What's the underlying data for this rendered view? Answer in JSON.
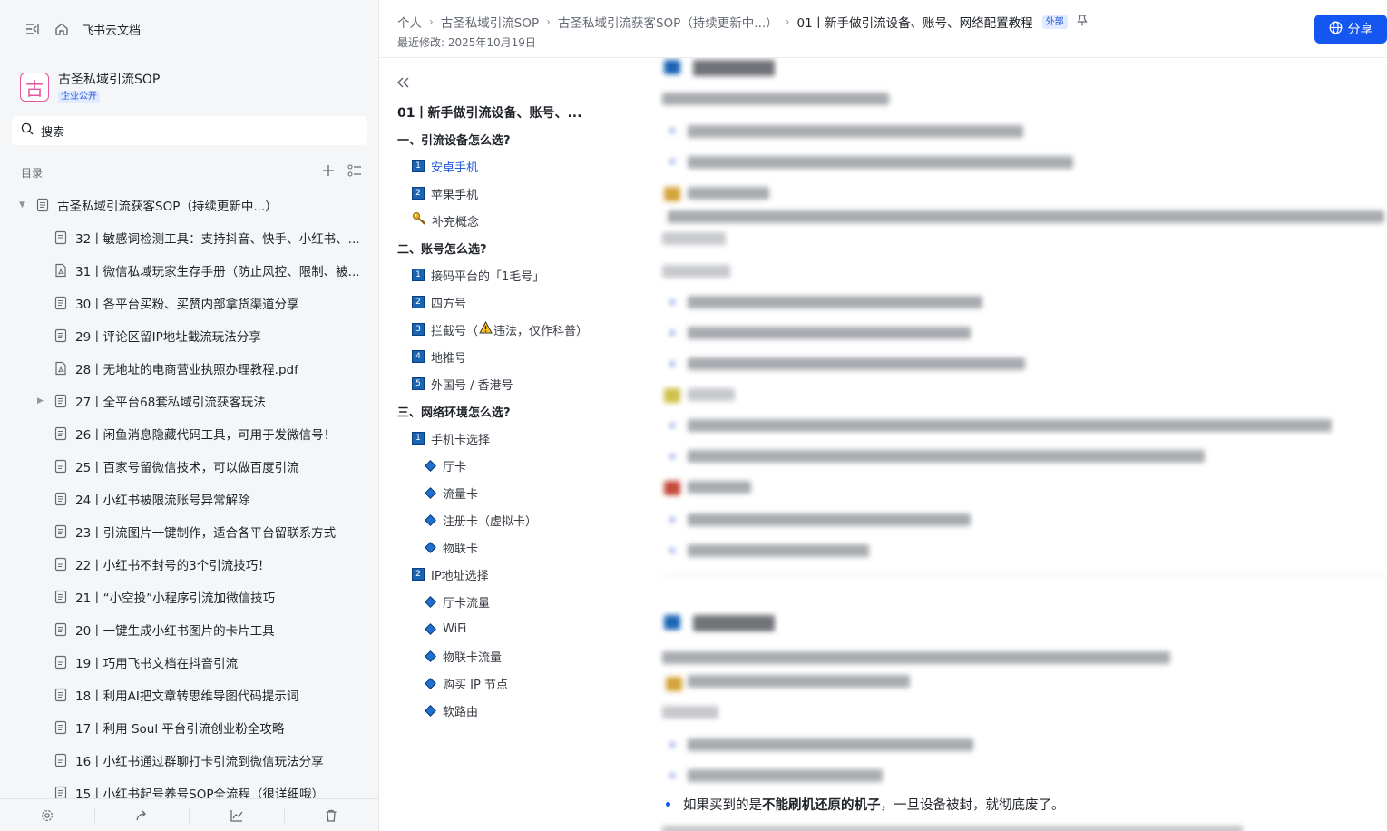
{
  "sidebar": {
    "home_label": "飞书云文档",
    "space": {
      "avatar_char": "古",
      "name": "古圣私域引流SOP",
      "tag": "企业公开"
    },
    "search_placeholder": "搜索",
    "toc_label": "目录",
    "tree": [
      {
        "label": "古圣私域引流获客SOP（持续更新中...）",
        "level": 0,
        "expanded": true,
        "icon": "doc-icon"
      },
      {
        "label": "32丨敏感词检测工具：支持抖音、快手、小红书、...",
        "level": 1,
        "icon": "doc-icon"
      },
      {
        "label": "31丨微信私域玩家生存手册（防止风控、限制、被...",
        "level": 1,
        "icon": "pdf-icon"
      },
      {
        "label": "30丨各平台买粉、买赞内部拿货渠道分享",
        "level": 1,
        "icon": "doc-icon"
      },
      {
        "label": "29丨评论区留IP地址截流玩法分享",
        "level": 1,
        "icon": "doc-icon"
      },
      {
        "label": "28丨无地址的电商营业执照办理教程.pdf",
        "level": 1,
        "icon": "pdf-icon"
      },
      {
        "label": "27丨全平台68套私域引流获客玩法",
        "level": 1,
        "icon": "doc-icon",
        "collapsed": true
      },
      {
        "label": "26丨闲鱼消息隐藏代码工具，可用于发微信号！",
        "level": 1,
        "icon": "doc-icon"
      },
      {
        "label": "25丨百家号留微信技术，可以做百度引流",
        "level": 1,
        "icon": "doc-icon"
      },
      {
        "label": "24丨小红书被限流账号异常解除",
        "level": 1,
        "icon": "doc-icon"
      },
      {
        "label": "23丨引流图片一键制作，适合各平台留联系方式",
        "level": 1,
        "icon": "doc-icon"
      },
      {
        "label": "22丨小红书不封号的3个引流技巧！",
        "level": 1,
        "icon": "doc-icon"
      },
      {
        "label": "21丨“小空投”小程序引流加微信技巧",
        "level": 1,
        "icon": "doc-icon"
      },
      {
        "label": "20丨一键生成小红书图片的卡片工具",
        "level": 1,
        "icon": "doc-icon"
      },
      {
        "label": "19丨巧用飞书文档在抖音引流",
        "level": 1,
        "icon": "doc-icon"
      },
      {
        "label": "18丨利用AI把文章转思维导图代码提示词",
        "level": 1,
        "icon": "doc-icon"
      },
      {
        "label": "17丨利用 Soul 平台引流创业粉全攻略",
        "level": 1,
        "icon": "doc-icon"
      },
      {
        "label": "16丨小红书通过群聊打卡引流到微信玩法分享",
        "level": 1,
        "icon": "doc-icon"
      },
      {
        "label": "15丨小红书起号养号SOP全流程（很详细哦）",
        "level": 1,
        "icon": "doc-icon"
      }
    ],
    "bottom_actions": [
      "settings-icon",
      "share-out-icon",
      "analytics-icon",
      "trash-icon"
    ]
  },
  "header": {
    "breadcrumbs": [
      "个人",
      "古圣私域引流SOP",
      "古圣私域引流获客SOP（持续更新中...）",
      "01丨新手做引流设备、账号、网络配置教程"
    ],
    "external_tag": "外部",
    "last_modified": "最近修改: 2025年10月19日",
    "share_label": "分享"
  },
  "outline": {
    "title": "01丨新手做引流设备、账号、...",
    "items": [
      {
        "label": "一、引流设备怎么选?",
        "level": 1
      },
      {
        "label": "安卓手机",
        "level": 2,
        "num": "1",
        "active": true
      },
      {
        "label": "苹果手机",
        "level": 2,
        "num": "2"
      },
      {
        "label": "补充概念",
        "level": 2,
        "icon": "key-icon"
      },
      {
        "label": "二、账号怎么选?",
        "level": 1
      },
      {
        "label": "接码平台的「1毛号」",
        "level": 2,
        "num": "1"
      },
      {
        "label": "四方号",
        "level": 2,
        "num": "2"
      },
      {
        "label": "拦截号（",
        "suffix": "违法，仅作科普）",
        "level": 2,
        "num": "3",
        "warn": true
      },
      {
        "label": "地推号",
        "level": 2,
        "num": "4"
      },
      {
        "label": "外国号 / 香港号",
        "level": 2,
        "num": "5"
      },
      {
        "label": "三、网络环境怎么选?",
        "level": 1
      },
      {
        "label": "手机卡选择",
        "level": 2,
        "num": "1"
      },
      {
        "label": "厅卡",
        "level": 3
      },
      {
        "label": "流量卡",
        "level": 3
      },
      {
        "label": "注册卡（虚拟卡）",
        "level": 3
      },
      {
        "label": "物联卡",
        "level": 3
      },
      {
        "label": "IP地址选择",
        "level": 2,
        "num": "2"
      },
      {
        "label": "厅卡流量",
        "level": 3
      },
      {
        "label": "WiFi",
        "level": 3
      },
      {
        "label": "物联卡流量",
        "level": 3
      },
      {
        "label": "购买 IP 节点",
        "level": 3
      },
      {
        "label": "软路由",
        "level": 3
      }
    ]
  },
  "content": {
    "visible_sentence": {
      "prefix": "如果买到的是",
      "bold": "不能刷机还原的机子",
      "suffix": "，一旦设备被封，就彻底废了。"
    }
  }
}
